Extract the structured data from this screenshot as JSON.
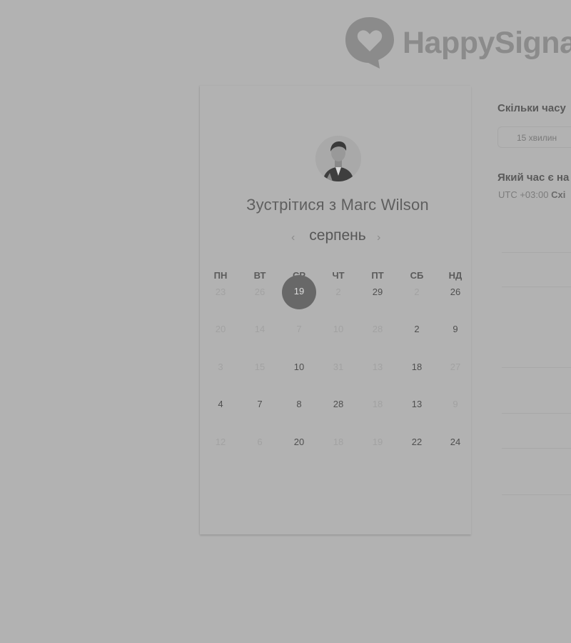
{
  "brand": {
    "name": "HappySigna"
  },
  "calendar": {
    "title_prefix": "Зустрітися з",
    "host_name": "Marc Wilson",
    "month": "серпень",
    "prev_icon": "‹",
    "next_icon": "›",
    "weekdays": [
      "ПН",
      "ВТ",
      "СР",
      "ЧТ",
      "ПТ",
      "СБ",
      "НД"
    ],
    "weeks": [
      [
        {
          "d": "23",
          "s": "off"
        },
        {
          "d": "26",
          "s": "off"
        },
        {
          "d": "19",
          "s": "sel"
        },
        {
          "d": "2",
          "s": "off"
        },
        {
          "d": "29",
          "s": "on"
        },
        {
          "d": "2",
          "s": "off"
        },
        {
          "d": "26",
          "s": "on"
        }
      ],
      [
        {
          "d": "20",
          "s": "off"
        },
        {
          "d": "14",
          "s": "off"
        },
        {
          "d": "7",
          "s": "off"
        },
        {
          "d": "10",
          "s": "off"
        },
        {
          "d": "28",
          "s": "off"
        },
        {
          "d": "2",
          "s": "on"
        },
        {
          "d": "9",
          "s": "on"
        }
      ],
      [
        {
          "d": "3",
          "s": "off"
        },
        {
          "d": "15",
          "s": "off"
        },
        {
          "d": "10",
          "s": "on"
        },
        {
          "d": "31",
          "s": "off"
        },
        {
          "d": "13",
          "s": "off"
        },
        {
          "d": "18",
          "s": "on"
        },
        {
          "d": "27",
          "s": "off"
        }
      ],
      [
        {
          "d": "4",
          "s": "on"
        },
        {
          "d": "7",
          "s": "on"
        },
        {
          "d": "8",
          "s": "on"
        },
        {
          "d": "28",
          "s": "on"
        },
        {
          "d": "18",
          "s": "off"
        },
        {
          "d": "13",
          "s": "on"
        },
        {
          "d": "9",
          "s": "off"
        }
      ],
      [
        {
          "d": "12",
          "s": "off"
        },
        {
          "d": "6",
          "s": "off"
        },
        {
          "d": "20",
          "s": "on"
        },
        {
          "d": "18",
          "s": "off"
        },
        {
          "d": "19",
          "s": "off"
        },
        {
          "d": "22",
          "s": "on"
        },
        {
          "d": "24",
          "s": "on"
        }
      ]
    ]
  },
  "booking": {
    "duration_question": "Скільки часу",
    "duration_value": "15 хвилин",
    "time_question": "Який час є на",
    "timezone_offset": "UTC +03:00",
    "timezone_name": "Схі"
  }
}
